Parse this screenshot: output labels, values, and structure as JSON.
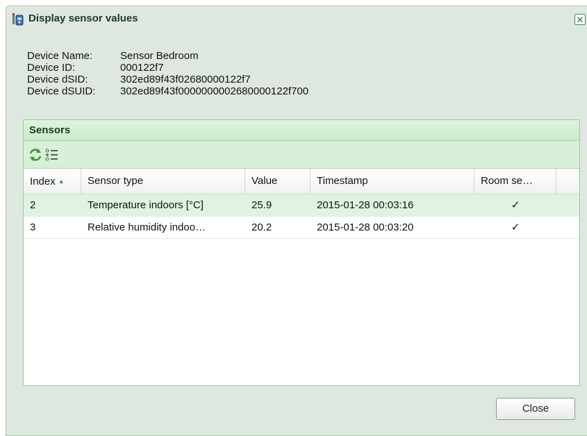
{
  "window": {
    "title": "Display sensor values",
    "close_glyph": "✕"
  },
  "device": {
    "rows": [
      {
        "label": "Device Name:",
        "value": "Sensor Bedroom"
      },
      {
        "label": "Device ID:",
        "value": "000122f7"
      },
      {
        "label": "Device dSID:",
        "value": "302ed89f43f02680000122f7"
      },
      {
        "label": "Device dSUID:",
        "value": "302ed89f43f0000000002680000122f700"
      }
    ]
  },
  "sensors": {
    "title": "Sensors",
    "toolbar": {
      "refresh_icon": "refresh-icon",
      "list_icon": "list-icon"
    },
    "columns": [
      "Index",
      "Sensor type",
      "Value",
      "Timestamp",
      "Room se…"
    ],
    "sort": {
      "column": "Index",
      "direction": "asc",
      "glyph": "▲"
    },
    "rows": [
      {
        "index": "2",
        "type": "Temperature indoors [°C]",
        "value": "25.9",
        "timestamp": "2015-01-28 00:03:16",
        "room": "✓"
      },
      {
        "index": "3",
        "type": "Relative humidity indoo…",
        "value": "20.2",
        "timestamp": "2015-01-28 00:03:20",
        "room": "✓"
      }
    ]
  },
  "footer": {
    "close_label": "Close"
  },
  "colors": {
    "accent": "#2d7a3c",
    "panel_border": "#8fcf99",
    "selected_row": "#e0f3e3"
  }
}
